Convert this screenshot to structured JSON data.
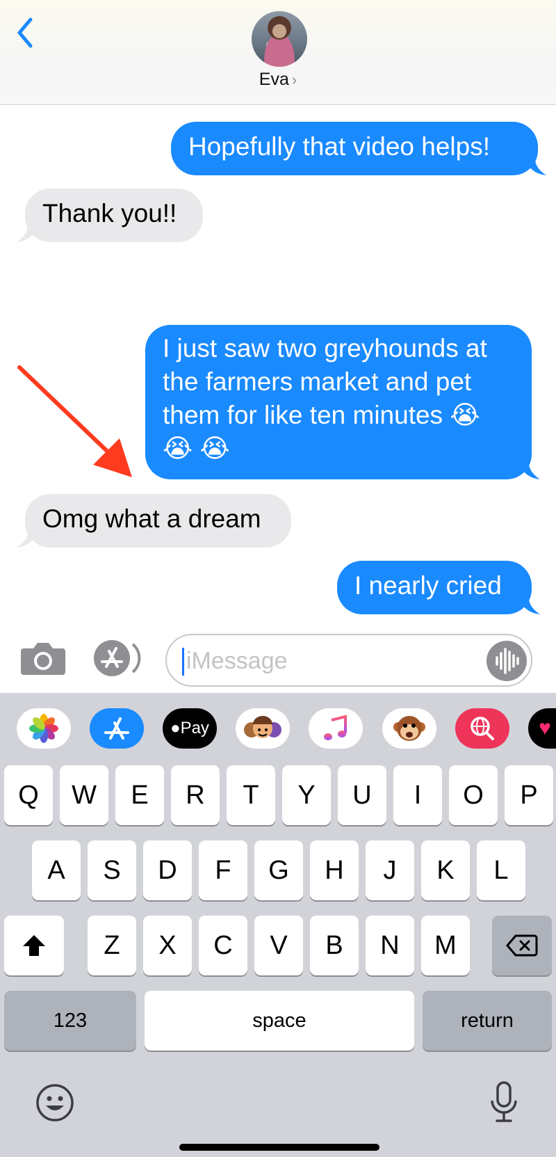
{
  "header": {
    "contact_name": "Eva",
    "chevron": "›",
    "back_icon": "chevron-left-icon",
    "accent_color": "#1a8aff"
  },
  "messages": [
    {
      "direction": "outgoing",
      "text": "Hopefully that video helps!"
    },
    {
      "direction": "incoming",
      "text": "Thank you!!"
    },
    {
      "direction": "outgoing",
      "text": "I just saw two greyhounds at the farmers market and pet them for like ten minutes 😭 😭 😭"
    },
    {
      "direction": "incoming",
      "text": "Omg what a dream"
    },
    {
      "direction": "outgoing",
      "text": "I nearly cried"
    }
  ],
  "annotation": {
    "icon": "red-arrow-icon",
    "color": "#ff3b1f"
  },
  "composer": {
    "placeholder": "iMessage",
    "camera_icon": "camera-icon",
    "apps_icon": "app-store-icon",
    "audio_icon": "audio-waveform-icon"
  },
  "app_strip": [
    {
      "name": "photos-app-icon"
    },
    {
      "name": "app-store-app-icon"
    },
    {
      "name": "apple-pay-app-icon",
      "label": "Pay"
    },
    {
      "name": "memoji-app-icon"
    },
    {
      "name": "music-app-icon"
    },
    {
      "name": "animoji-app-icon"
    },
    {
      "name": "search-images-app-icon"
    },
    {
      "name": "digital-touch-app-icon"
    }
  ],
  "keyboard": {
    "row1": [
      "Q",
      "W",
      "E",
      "R",
      "T",
      "Y",
      "U",
      "I",
      "O",
      "P"
    ],
    "row2": [
      "A",
      "S",
      "D",
      "F",
      "G",
      "H",
      "J",
      "K",
      "L"
    ],
    "row3": [
      "Z",
      "X",
      "C",
      "V",
      "B",
      "N",
      "M"
    ],
    "numbers_label": "123",
    "space_label": "space",
    "return_label": "return",
    "shift_icon": "shift-icon",
    "delete_icon": "delete-icon",
    "emoji_icon": "emoji-icon",
    "dictation_icon": "microphone-icon"
  }
}
